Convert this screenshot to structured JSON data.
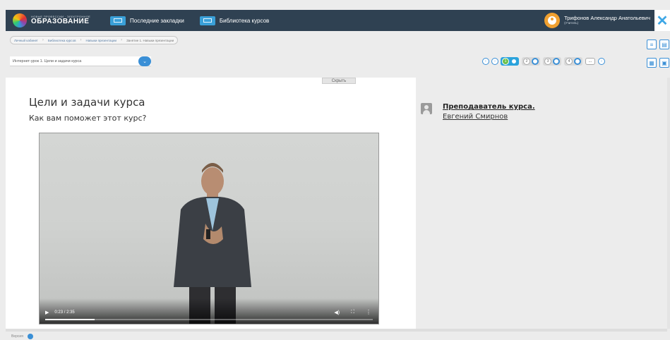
{
  "header": {
    "logo_small": "НОВЫЕ ПРОФЕССИИ · ЭЛЕКТРОННОЕ",
    "logo_big": "ОБРАЗОВАНИЕ",
    "nav": [
      {
        "label": "Последние закладки"
      },
      {
        "label": "Библиотека курсов"
      }
    ],
    "user_name": "Трифонов Александр Анатольевич",
    "user_role": "(Учитель)",
    "close": "✕"
  },
  "breadcrumbs": [
    "Личный кабинет",
    "Библиотека курсов",
    "Навыки презентации",
    "Занятие 1. Навыки презентации"
  ],
  "lesson_select": {
    "value": "Интернет-урок 1. Цели и задачи курса"
  },
  "steps": {
    "groups": [
      "1",
      "2",
      "3",
      "4"
    ],
    "active_group": "1",
    "more_label": "..."
  },
  "hide_label": "Скрыть",
  "main": {
    "title": "Цели и задачи курса",
    "subtitle": "Как вам поможет этот курс?"
  },
  "video": {
    "time": "0:23 / 2:35",
    "progress": 0.15
  },
  "side": {
    "teacher_label": "Преподаватель курса.",
    "teacher_name": "Евгений Смирнов"
  },
  "footer": {
    "label": "Версия"
  },
  "colors": {
    "topbar": "#2f4152",
    "accent": "#3a8fd6",
    "active_step": "#2ba3dc"
  }
}
